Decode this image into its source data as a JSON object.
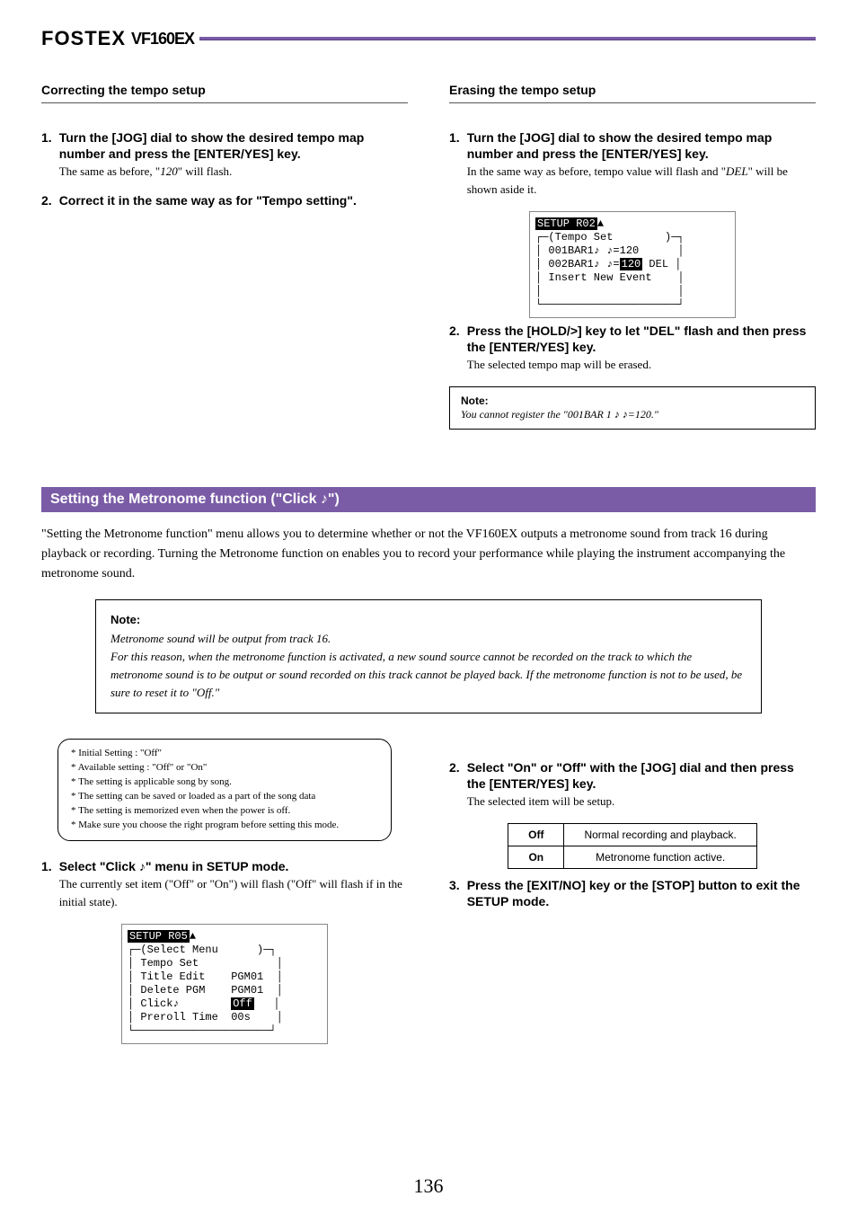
{
  "header": {
    "logo": "FOSTEX",
    "model": "VF160EX"
  },
  "left": {
    "sec_title": "Correcting the tempo setup",
    "p1_pre": "The same as before, \"",
    "p1_flash": "120",
    "p1_post": "\" will flash.",
    "step1": {
      "num": "1.",
      "title": "Turn the [JOG] dial to show the desired tempo map number and press the [ENTER/YES] key."
    },
    "step2": {
      "num": "2.",
      "title": "Correct it in the same way as for \"Tempo setting\"."
    }
  },
  "right": {
    "sec_title": "Erasing the tempo setup",
    "step1": {
      "num": "1.",
      "title": "Turn the [JOG] dial to show the desired tempo map number and press the [ENTER/YES] key.",
      "desc_pre": "In the same way as before, tempo value will flash and \"",
      "desc_ins": "DEL",
      "desc_post": "\" will be shown aside it."
    },
    "step2": {
      "num": "2.",
      "title": "Press the [HOLD/>] key to let \"DEL\" flash and then press the [ENTER/YES] key.",
      "desc": "The selected tempo map will be erased."
    },
    "boxnote_lead": "Note:",
    "boxnote_body": "You cannot register the \"001BAR 1 ♪ ♪=120.\""
  },
  "lcd1": {
    "l1_inv": "SETUP R02",
    "l1_rest": "▲",
    "l2": "┌─(Tempo Set        )─┐",
    "l3": "│ 001BAR1♪ ♪=120      │",
    "l4": "│ 002BAR1♪ ♪=",
    "l4_inv": "120",
    "l4_rest": " DEL │",
    "l5": "│ Insert New Event    │",
    "l6": "│                     │",
    "l7": "└─────────────────────┘"
  },
  "section": {
    "bar": "Setting the Metronome function (\"Click ♪\")",
    "body": "\"Setting the Metronome function\" menu allows you to determine whether or not the VF160EX outputs a metronome sound from track 16 during playback or recording.  Turning the Metronome function on enables you to record your performance while playing the instrument accompanying the metronome sound.",
    "notehead": "Note:",
    "note": "Metronome sound will be output from track 16.\nFor this reason, when the metronome function is activated, a new sound source cannot be recorded on the track to which the metronome sound is to be output or sound recorded on this track cannot be played back. If the metronome function is not to be used, be sure to reset it to \"Off.\"",
    "spec": [
      "Initial Setting               :   \"Off\"",
      "Available setting             :   \"Off\" or \"On\"",
      "The setting is applicable song by song.",
      "The setting can be saved or loaded as a part of the song data",
      "The setting is memorized even when the power is off.",
      "Make sure you choose the right program before setting this mode."
    ],
    "l_step1": {
      "num": "1.",
      "title": "Select \"Click ♪\" menu in SETUP mode.",
      "desc": "The currently set item (\"Off\" or \"On\") will flash (\"Off\" will flash if in the initial state)."
    },
    "r_step2": {
      "num": "2.",
      "title": "Select \"On\" or \"Off\" with the [JOG] dial and then press the [ENTER/YES] key.",
      "desc": "The selected item will be setup."
    },
    "r_step3": {
      "num": "3.",
      "title": "Press the [EXIT/NO] key or the [STOP] button to exit the SETUP mode."
    },
    "table": {
      "h1": "Off",
      "h1v": "Normal recording and playback.",
      "h2": "On",
      "h2v": "Metronome function active."
    }
  },
  "lcd2": {
    "l1_inv": "SETUP R05",
    "l1_rest": "▲",
    "l2": "┌─(Select Menu      )─┐",
    "l3": "│ Tempo Set            │",
    "l4": "│ Title Edit    PGM01  │",
    "l5": "│ Delete PGM    PGM01  │",
    "l6_pre": "│ Click♪        ",
    "l6_inv": "Off",
    "l6_post": "   │",
    "l7": "│ Preroll Time  00s    │",
    "l8": "└─────────────────────┘"
  },
  "pagenum": "136"
}
